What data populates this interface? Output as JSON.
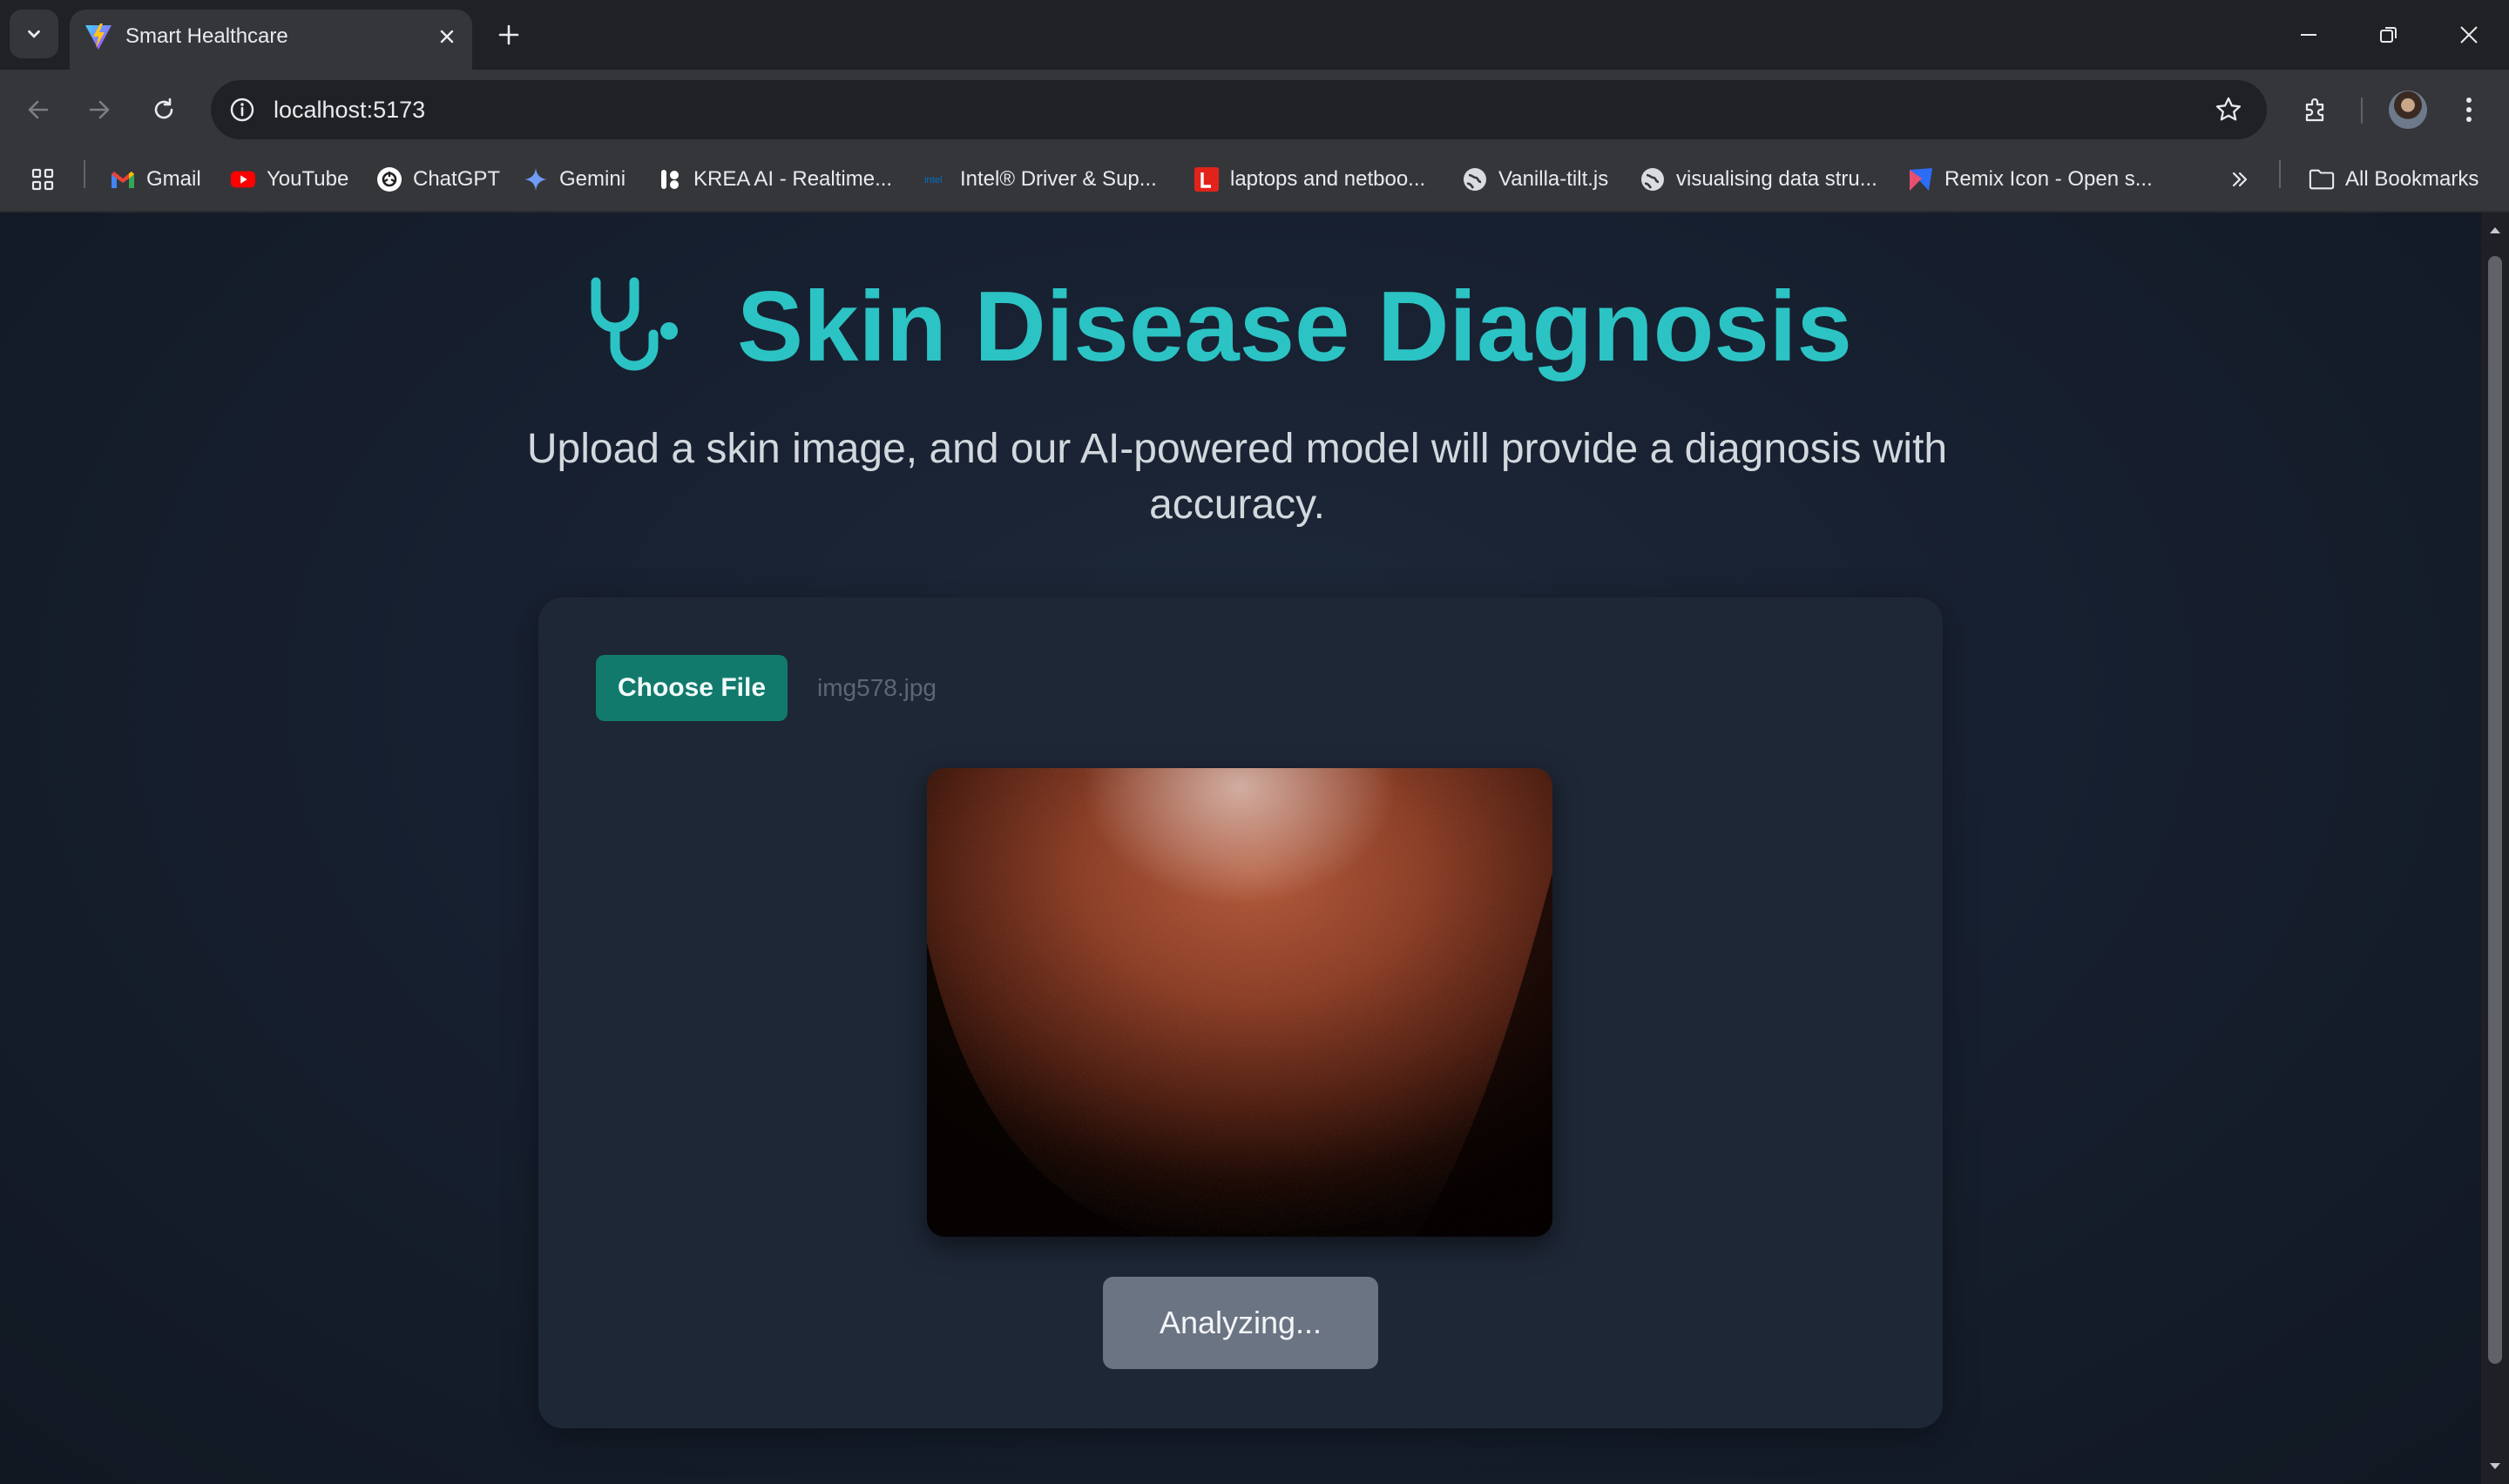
{
  "browser": {
    "tab_title": "Smart Healthcare",
    "url": "localhost:5173",
    "bookmarks": [
      {
        "label": "Gmail",
        "icon": "gmail-icon"
      },
      {
        "label": "YouTube",
        "icon": "youtube-icon"
      },
      {
        "label": "ChatGPT",
        "icon": "chatgpt-icon"
      },
      {
        "label": "Gemini",
        "icon": "gemini-icon"
      },
      {
        "label": "KREA AI - Realtime...",
        "icon": "krea-icon"
      },
      {
        "label": "Intel® Driver & Sup...",
        "icon": "intel-icon"
      },
      {
        "label": "laptops and netboo...",
        "icon": "lenovo-icon"
      },
      {
        "label": "Vanilla-tilt.js",
        "icon": "globe-icon"
      },
      {
        "label": "visualising data stru...",
        "icon": "globe-icon"
      },
      {
        "label": "Remix Icon - Open s...",
        "icon": "remix-icon"
      }
    ],
    "all_bookmarks": "All Bookmarks"
  },
  "page": {
    "title": "Skin Disease Diagnosis",
    "subtitle": "Upload a skin image, and our AI-powered model will provide a diagnosis with accuracy.",
    "choose_file_label": "Choose File",
    "file_name": "img578.jpg",
    "analyze_button": "Analyzing...",
    "accent_color": "#2cc3c4",
    "button_color": "#117a6d"
  }
}
